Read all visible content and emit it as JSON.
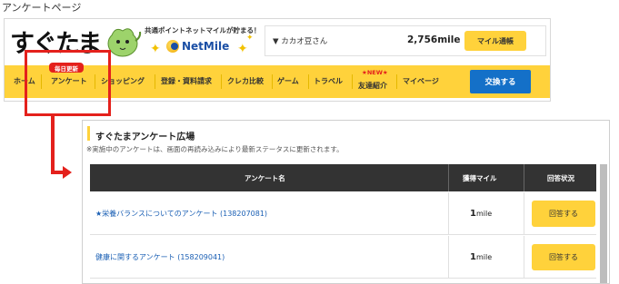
{
  "caption": "アンケートページ",
  "site": {
    "logo": "すぐたま",
    "tagline": "共通ポイントネットマイルが貯まる！",
    "netmile": "NetMile",
    "user": "▼ カカオ豆さん",
    "mile_amount": "2,756mile",
    "mile_button": "マイル通帳",
    "badge": "毎日更新",
    "new_mark": "★NEW★",
    "exchange_button": "交換する",
    "nav": [
      "ホーム",
      "アンケート",
      "ショッピング",
      "登録・資料請求",
      "クレカ比較",
      "ゲーム",
      "トラベル",
      "友達紹介",
      "マイページ"
    ]
  },
  "panel": {
    "title": "すぐたまアンケート広場",
    "note": "※実施中のアンケートは、画面の再読み込みにより最新ステータスに更新されます。",
    "columns": [
      "アンケート名",
      "獲得マイル",
      "回答状況"
    ],
    "rows": [
      {
        "name": "★栄養バランスについてのアンケート (138207081)",
        "mile_num": "1",
        "mile_unit": "mile",
        "action": "回答する"
      },
      {
        "name": "健康に関するアンケート (158209041)",
        "mile_num": "1",
        "mile_unit": "mile",
        "action": "回答する"
      }
    ]
  },
  "colors": {
    "brand_yellow": "#ffd23b",
    "highlight_red": "#e4211c",
    "exchange_blue": "#1470c8",
    "link_blue": "#1a5fb4"
  }
}
